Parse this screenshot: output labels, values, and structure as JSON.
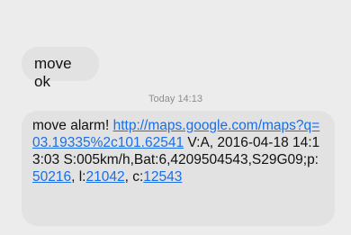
{
  "messages": [
    {
      "text": "move ok"
    },
    {
      "timestamp_day": "Today",
      "timestamp_time": "14:13"
    },
    {
      "prefix": "move alarm! ",
      "link1": "http://maps.google.com/maps?q=03.19335%2c101.62541",
      "mid1": "  V:A, 2016-04-18 14:13:03 S:005km/h,Bat:6,4209504543,S29G09;p:",
      "link2": "50216",
      "mid2": ", l:",
      "link3": "21042",
      "mid3": ", c:",
      "link4": "12543"
    }
  ],
  "colors": {
    "background": "#ececec",
    "bubble": "#e2e2e2",
    "link": "#1a6ee6",
    "timestamp": "#8e8e93"
  }
}
